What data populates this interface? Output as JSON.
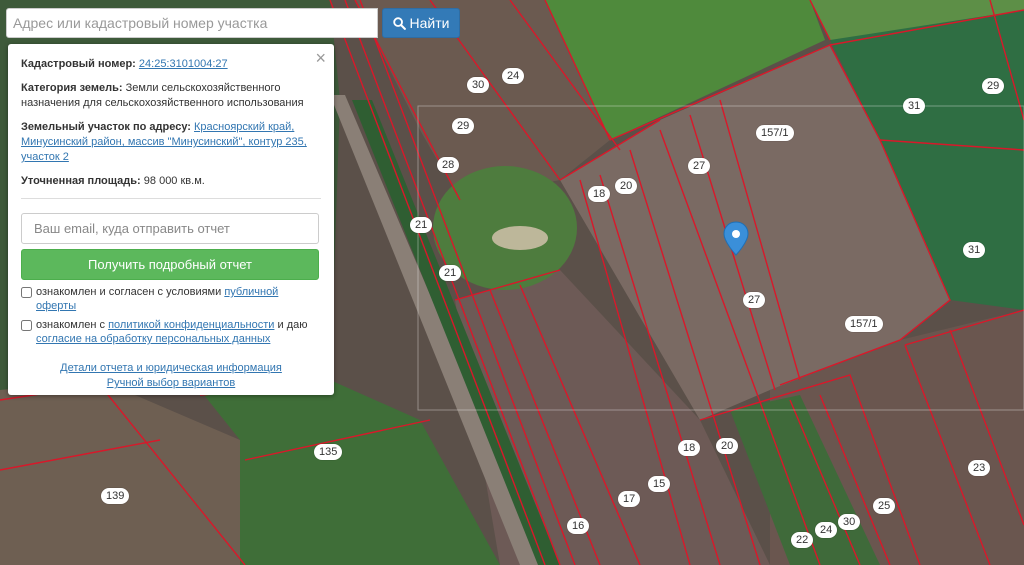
{
  "search": {
    "placeholder": "Адрес или кадастровый номер участка",
    "button_label": "Найти"
  },
  "panel": {
    "cadastral_label": "Кадастровый номер:",
    "cadastral_value": "24:25:3101004:27",
    "category_label": "Категория земель:",
    "category_value": "Земли сельскохозяйственного назначения для сельскохозяйственного использования",
    "address_label": "Земельный участок по адресу:",
    "address_value": "Красноярский край, Минусинский район, массив \"Минусинский\", контур 235, участок 2",
    "area_label": "Уточненная площадь:",
    "area_value": "98 000 кв.м.",
    "email_placeholder": "Ваш email, куда отправить отчет",
    "report_button": "Получить подробный отчет",
    "consent1_text": "ознакомлен и согласен с условиями ",
    "consent1_link": "публичной оферты",
    "consent2_text": "ознакомлен с ",
    "consent2_link": "политикой конфиденциальности",
    "consent2_text2": " и даю",
    "consent2_link2": "согласие на обработку персональных данных",
    "details_link": "Детали отчета и юридическая информация",
    "manual_link": "Ручной выбор вариантов"
  },
  "map": {
    "parcel_labels": [
      "30",
      "24",
      "29",
      "28",
      "21",
      "21",
      "18",
      "20",
      "27",
      "157/1",
      "27",
      "157/1",
      "31",
      "29",
      "31",
      "135",
      "139",
      "18",
      "20",
      "17",
      "15",
      "16",
      "23",
      "25",
      "30",
      "24",
      "22"
    ]
  },
  "colors": {
    "parcel_border": "#d9182a",
    "primary_button": "#337ab7",
    "success_button": "#5cb85c",
    "link": "#3276b1",
    "marker": "#3a8fd9"
  }
}
